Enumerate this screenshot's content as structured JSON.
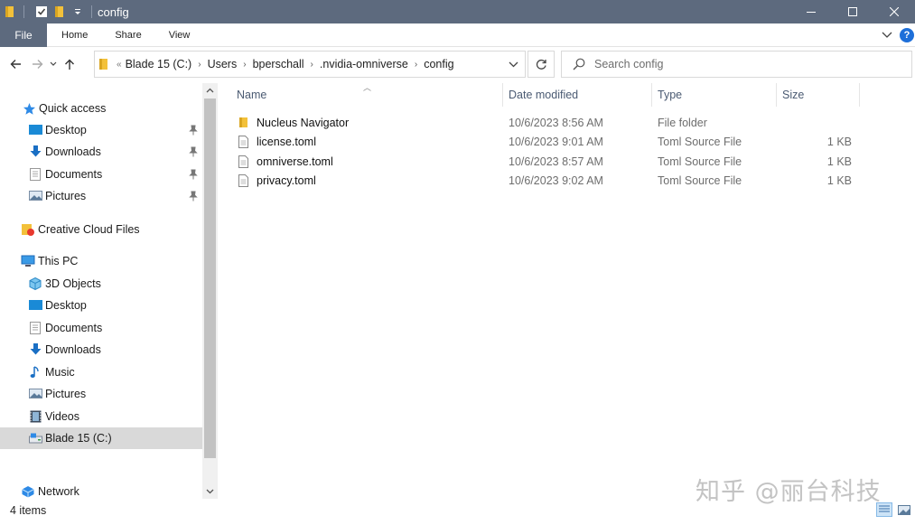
{
  "window": {
    "title": "config",
    "qa_icons": [
      "folder-icon",
      "properties-icon",
      "new-folder-icon",
      "customize-dropdown-icon"
    ],
    "controls": [
      "minimize-icon",
      "maximize-icon",
      "close-icon"
    ]
  },
  "ribbon": {
    "file": "File",
    "tabs": [
      "Home",
      "Share",
      "View"
    ]
  },
  "nav": {
    "breadcrumbs": [
      "Blade 15 (C:)",
      "Users",
      "bperschall",
      ".nvidia-omniverse",
      "config"
    ],
    "overflow": "«",
    "search_placeholder": "Search config"
  },
  "sidebar": {
    "quick_access": "Quick access",
    "quick_items": [
      "Desktop",
      "Downloads",
      "Documents",
      "Pictures"
    ],
    "creative_cloud": "Creative Cloud Files",
    "this_pc": "This PC",
    "pc_items": [
      "3D Objects",
      "Desktop",
      "Documents",
      "Downloads",
      "Music",
      "Pictures",
      "Videos",
      "Blade 15 (C:)"
    ],
    "network": "Network",
    "selected": "Blade 15 (C:)"
  },
  "columns": {
    "name": "Name",
    "date": "Date modified",
    "type": "Type",
    "size": "Size"
  },
  "files": [
    {
      "name": "Nucleus Navigator",
      "date": "10/6/2023 8:56 AM",
      "type": "File folder",
      "size": "",
      "icon": "folder-icon"
    },
    {
      "name": "license.toml",
      "date": "10/6/2023 9:01 AM",
      "type": "Toml Source File",
      "size": "1 KB",
      "icon": "file-icon"
    },
    {
      "name": "omniverse.toml",
      "date": "10/6/2023 8:57 AM",
      "type": "Toml Source File",
      "size": "1 KB",
      "icon": "file-icon"
    },
    {
      "name": "privacy.toml",
      "date": "10/6/2023 9:02 AM",
      "type": "Toml Source File",
      "size": "1 KB",
      "icon": "file-icon"
    }
  ],
  "status": {
    "item_count": "4 items"
  },
  "watermark": "知乎 @丽台科技",
  "colors": {
    "titlebar": "#5d6a7e",
    "folder": "#f3c13a",
    "selection": "#d9d9d9",
    "accent": "#1e6fd9"
  }
}
